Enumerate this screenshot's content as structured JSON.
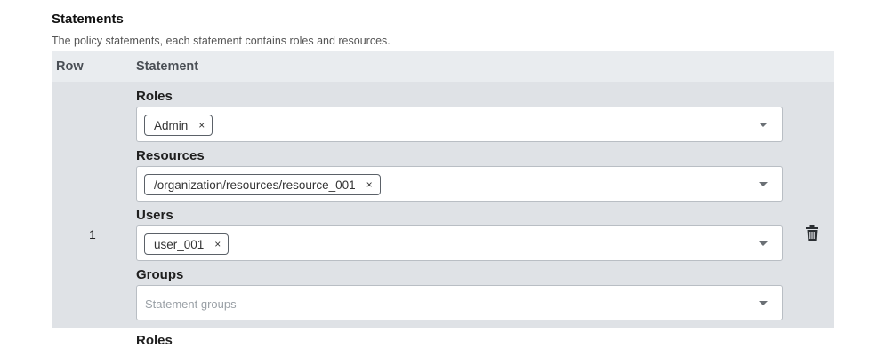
{
  "section": {
    "title": "Statements",
    "description": "The policy statements, each statement contains roles and resources."
  },
  "table": {
    "headers": {
      "row": "Row",
      "statement": "Statement"
    },
    "rows": [
      {
        "number": "1",
        "roles": {
          "label": "Roles",
          "chips": [
            "Admin"
          ]
        },
        "resources": {
          "label": "Resources",
          "chips": [
            "/organization/resources/resource_001"
          ]
        },
        "users": {
          "label": "Users",
          "chips": [
            "user_001"
          ]
        },
        "groups": {
          "label": "Groups",
          "placeholder": "Statement groups"
        },
        "delete_icon": "trash-icon"
      }
    ],
    "next_row_partial_label": "Roles"
  },
  "chip_remove_glyph": "×",
  "colors": {
    "header_bg": "#e9ecef",
    "row_bg": "#dfe2e6",
    "field_border": "#b9bec4"
  }
}
